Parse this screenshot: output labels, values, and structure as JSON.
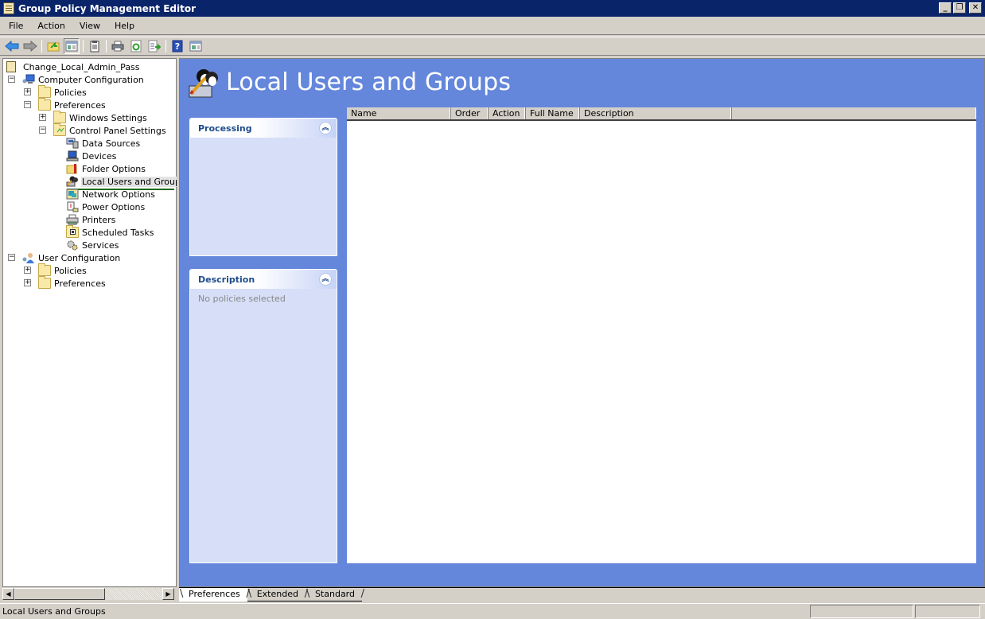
{
  "window": {
    "title": "Group Policy Management Editor",
    "controls": {
      "minimize": "_",
      "restore": "❐",
      "close": "✕"
    }
  },
  "menubar": {
    "items": [
      "File",
      "Action",
      "View",
      "Help"
    ]
  },
  "toolbar": {
    "buttons": [
      {
        "name": "back",
        "icon": "arrow-left-icon"
      },
      {
        "name": "forward",
        "icon": "arrow-right-icon"
      },
      {
        "name": "up-level",
        "icon": "folder-up-icon"
      },
      {
        "name": "show-hide-console-tree",
        "icon": "console-tree-icon",
        "pressed": true
      },
      {
        "name": "properties",
        "icon": "clipboard-icon"
      },
      {
        "name": "print",
        "icon": "printer-icon"
      },
      {
        "name": "refresh",
        "icon": "refresh-icon"
      },
      {
        "name": "export-list",
        "icon": "export-icon"
      },
      {
        "name": "help",
        "icon": "help-icon",
        "label": "?"
      },
      {
        "name": "show-hide-action-pane",
        "icon": "action-pane-icon"
      }
    ]
  },
  "tree": {
    "root": "Change_Local_Admin_Pass",
    "nodes": [
      {
        "label": "Computer Configuration",
        "expander": "−",
        "icon": "computer-config-icon"
      },
      {
        "label": "Policies",
        "expander": "+",
        "icon": "folder-icon"
      },
      {
        "label": "Preferences",
        "expander": "−",
        "icon": "folder-icon"
      },
      {
        "label": "Windows Settings",
        "expander": "+",
        "icon": "folder-icon"
      },
      {
        "label": "Control Panel Settings",
        "expander": "−",
        "icon": "control-panel-icon"
      },
      {
        "label": "Data Sources",
        "icon": "data-sources-icon"
      },
      {
        "label": "Devices",
        "icon": "devices-icon"
      },
      {
        "label": "Folder Options",
        "icon": "folder-options-icon"
      },
      {
        "label": "Local Users and Groups",
        "icon": "local-users-icon",
        "selected": true
      },
      {
        "label": "Network Options",
        "icon": "network-options-icon"
      },
      {
        "label": "Power Options",
        "icon": "power-options-icon"
      },
      {
        "label": "Printers",
        "icon": "printers-icon"
      },
      {
        "label": "Scheduled Tasks",
        "icon": "scheduled-tasks-icon"
      },
      {
        "label": "Services",
        "icon": "services-icon"
      },
      {
        "label": "User Configuration",
        "expander": "−",
        "icon": "user-config-icon"
      },
      {
        "label": "Policies",
        "expander": "+",
        "icon": "folder-icon"
      },
      {
        "label": "Preferences",
        "expander": "+",
        "icon": "folder-icon"
      }
    ]
  },
  "content": {
    "title": "Local Users and Groups",
    "processing_pane": {
      "title": "Processing",
      "collapse": "︽"
    },
    "description_pane": {
      "title": "Description",
      "collapse": "︽",
      "body": "No policies selected"
    },
    "list": {
      "columns": [
        "Name",
        "Order",
        "Action",
        "Full Name",
        "Description",
        ""
      ],
      "rows": []
    }
  },
  "tabs": {
    "items": [
      "Preferences",
      "Extended",
      "Standard"
    ],
    "active": "Preferences"
  },
  "statusbar": {
    "text": "Local Users and Groups"
  }
}
